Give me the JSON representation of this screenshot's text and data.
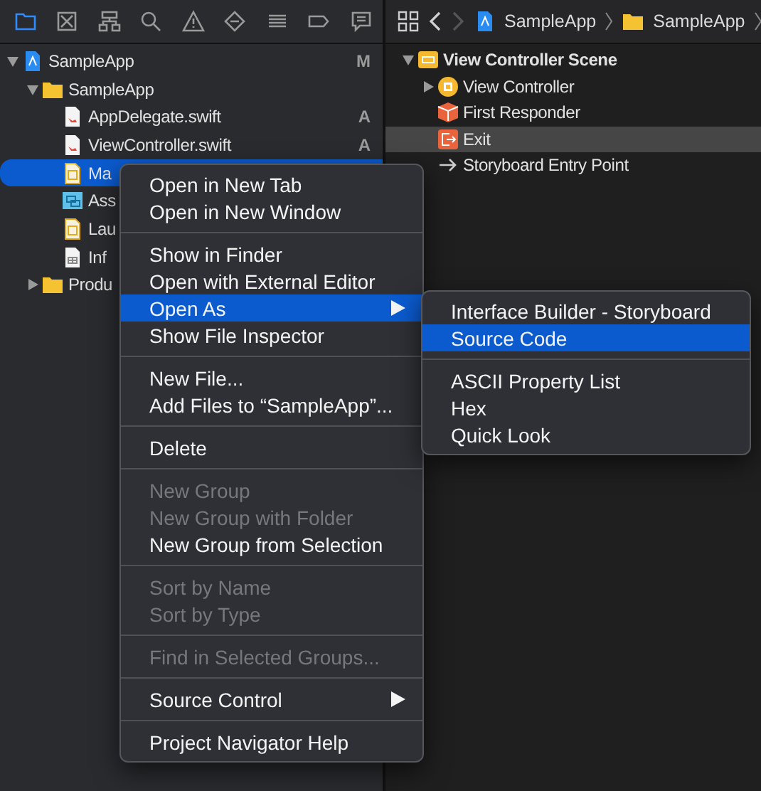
{
  "navigator": {
    "tabs": [
      {
        "selected": true
      },
      {
        "selected": false
      },
      {
        "selected": false
      },
      {
        "selected": false
      },
      {
        "selected": false
      },
      {
        "selected": false
      },
      {
        "selected": false
      },
      {
        "selected": false
      },
      {
        "selected": false
      }
    ],
    "tree": [
      {
        "kind": "project",
        "label": "SampleApp",
        "badge": "M",
        "expanded": true,
        "selected": false,
        "children": [
          {
            "kind": "folder",
            "label": "SampleApp",
            "expanded": true,
            "selected": false,
            "children": [
              {
                "kind": "swift",
                "label": "AppDelegate.swift",
                "badge": "A",
                "selected": false
              },
              {
                "kind": "swift",
                "label": "ViewController.swift",
                "badge": "A",
                "selected": false
              },
              {
                "kind": "storyboard",
                "label": "Ma",
                "selected": true
              },
              {
                "kind": "assets",
                "label": "Ass",
                "selected": false
              },
              {
                "kind": "storyboard",
                "label": "Lau",
                "selected": false
              },
              {
                "kind": "plist",
                "label": "Inf",
                "selected": false
              }
            ]
          },
          {
            "kind": "folder",
            "label": "Produ",
            "expanded": false,
            "selected": false
          }
        ]
      }
    ]
  },
  "editor": {
    "back_enabled": true,
    "forward_enabled": false,
    "breadcrumbs": [
      {
        "kind": "project",
        "label": "SampleApp"
      },
      {
        "kind": "folder",
        "label": "SampleApp"
      }
    ],
    "outline": [
      {
        "kind": "scene",
        "label": "View Controller Scene",
        "expanded": true,
        "selected": false,
        "children": [
          {
            "kind": "controller",
            "label": "View Controller",
            "expanded": false,
            "selected": false
          },
          {
            "kind": "responder",
            "label": "First Responder",
            "selected": false
          },
          {
            "kind": "exit",
            "label": "Exit",
            "selected": true
          },
          {
            "kind": "segue",
            "label": "Storyboard Entry Point",
            "selected": false
          }
        ]
      }
    ]
  },
  "context_menu": [
    {
      "kind": "item",
      "label": "Open in New Tab",
      "disabled": false,
      "selected": false,
      "submenu": false
    },
    {
      "kind": "item",
      "label": "Open in New Window",
      "disabled": false,
      "selected": false,
      "submenu": false
    },
    {
      "kind": "separator"
    },
    {
      "kind": "item",
      "label": "Show in Finder",
      "disabled": false,
      "selected": false,
      "submenu": false
    },
    {
      "kind": "item",
      "label": "Open with External Editor",
      "disabled": false,
      "selected": false,
      "submenu": false
    },
    {
      "kind": "item",
      "label": "Open As",
      "disabled": false,
      "selected": true,
      "submenu": true
    },
    {
      "kind": "item",
      "label": "Show File Inspector",
      "disabled": false,
      "selected": false,
      "submenu": false
    },
    {
      "kind": "separator"
    },
    {
      "kind": "item",
      "label": "New File...",
      "disabled": false,
      "selected": false,
      "submenu": false
    },
    {
      "kind": "item",
      "label": "Add Files to “SampleApp”...",
      "disabled": false,
      "selected": false,
      "submenu": false
    },
    {
      "kind": "separator"
    },
    {
      "kind": "item",
      "label": "Delete",
      "disabled": false,
      "selected": false,
      "submenu": false
    },
    {
      "kind": "separator"
    },
    {
      "kind": "item",
      "label": "New Group",
      "disabled": true,
      "selected": false,
      "submenu": false
    },
    {
      "kind": "item",
      "label": "New Group with Folder",
      "disabled": true,
      "selected": false,
      "submenu": false
    },
    {
      "kind": "item",
      "label": "New Group from Selection",
      "disabled": false,
      "selected": false,
      "submenu": false
    },
    {
      "kind": "separator"
    },
    {
      "kind": "item",
      "label": "Sort by Name",
      "disabled": true,
      "selected": false,
      "submenu": false
    },
    {
      "kind": "item",
      "label": "Sort by Type",
      "disabled": true,
      "selected": false,
      "submenu": false
    },
    {
      "kind": "separator"
    },
    {
      "kind": "item",
      "label": "Find in Selected Groups...",
      "disabled": true,
      "selected": false,
      "submenu": false
    },
    {
      "kind": "separator"
    },
    {
      "kind": "item",
      "label": "Source Control",
      "disabled": false,
      "selected": false,
      "submenu": true
    },
    {
      "kind": "separator"
    },
    {
      "kind": "item",
      "label": "Project Navigator Help",
      "disabled": false,
      "selected": false,
      "submenu": false
    }
  ],
  "submenu": [
    {
      "kind": "item",
      "label": "Interface Builder - Storyboard",
      "selected": false
    },
    {
      "kind": "item",
      "label": "Source Code",
      "selected": true
    },
    {
      "kind": "separator"
    },
    {
      "kind": "item",
      "label": "ASCII Property List",
      "selected": false
    },
    {
      "kind": "item",
      "label": "Hex",
      "selected": false
    },
    {
      "kind": "item",
      "label": "Quick Look",
      "selected": false
    }
  ]
}
